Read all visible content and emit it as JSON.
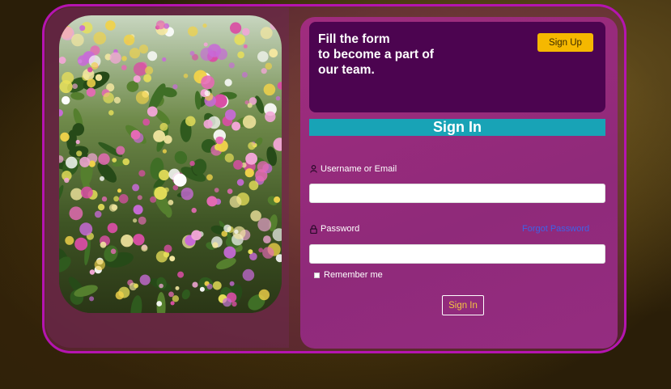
{
  "promo": {
    "line1": "Fill the form",
    "line2": "to become a part of",
    "line3": "our team.",
    "signup_label": "Sign Up"
  },
  "form": {
    "title": "Sign In",
    "username_label": "Username or Email",
    "username_value": "",
    "password_label": "Password",
    "password_value": "",
    "forgot_label": "Forgot Password",
    "remember_label": "Remember me",
    "remember_checked": false,
    "submit_label": "Sign In"
  },
  "icons": {
    "user": "user-icon",
    "lock": "lock-icon"
  },
  "colors": {
    "card_border": "#b514b0",
    "header_bg": "#4c0450",
    "title_bar": "#18a3b6",
    "signup_button": "#f5b800",
    "forgot_link": "#3d63e8",
    "submit_text": "#f5c542"
  }
}
